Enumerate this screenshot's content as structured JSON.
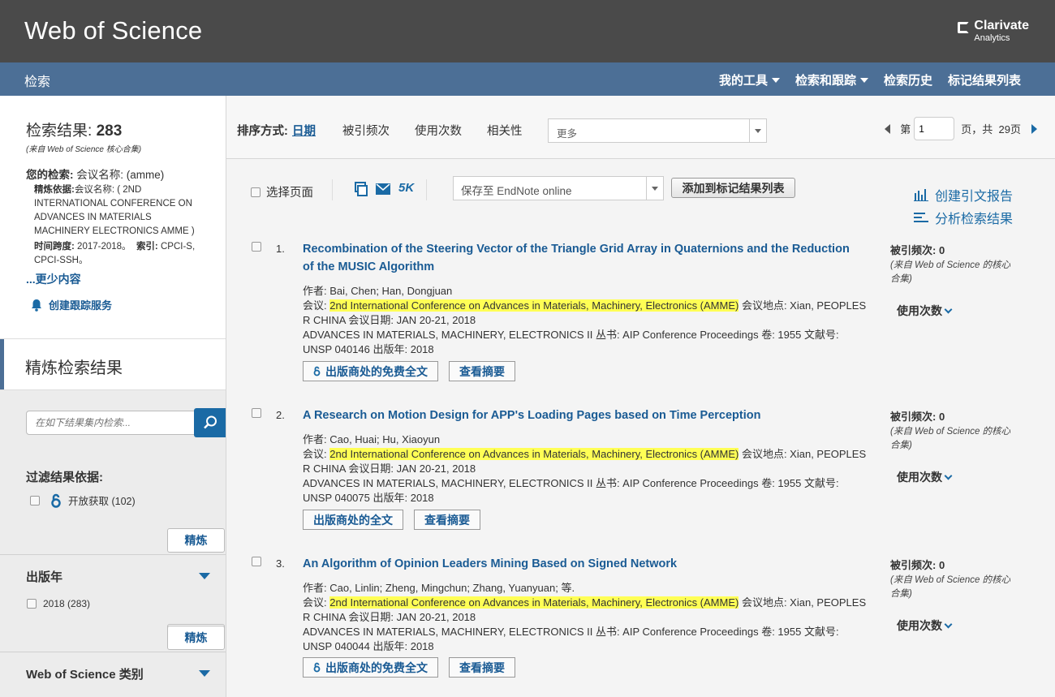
{
  "header": {
    "brand": "Web of Science",
    "logo_line1": "Clarivate",
    "logo_line2": "Analytics"
  },
  "nav": {
    "left": "检索",
    "items": [
      {
        "label": "我的工具",
        "dropdown": true
      },
      {
        "label": "检索和跟踪",
        "dropdown": true
      },
      {
        "label": "检索历史",
        "dropdown": false
      },
      {
        "label": "标记结果列表",
        "dropdown": false
      }
    ]
  },
  "sidebar": {
    "results_label": "检索结果:",
    "results_count": "283",
    "results_source": "(来自 Web of Science 核心合集)",
    "your_search_label": "您的检索:",
    "your_search_value": "会议名称: (amme)",
    "refined_by_label": "精炼依据:",
    "refined_by_value": "会议名称: ( 2ND INTERNATIONAL CONFERENCE ON ADVANCES IN MATERIALS MACHINERY ELECTRONICS AMME )",
    "timespan_label": "时间跨度:",
    "timespan_value": "2017-2018。",
    "index_label": "索引:",
    "index_value": "CPCI-S, CPCI-SSH。",
    "less_link": "...更少内容",
    "create_alert": "创建跟踪服务",
    "refine_title": "精炼检索结果",
    "search_placeholder": "在如下结果集内检索...",
    "filter_title": "过滤结果依据:",
    "open_access": "开放获取 (102)",
    "refine_btn": "精炼",
    "pub_year_title": "出版年",
    "year_2018": "2018 (283)",
    "wos_cat_title": "Web of Science 类别"
  },
  "sort": {
    "label": "排序方式:",
    "options": [
      "日期",
      "被引频次",
      "使用次数",
      "相关性"
    ],
    "more": "更多",
    "page_prefix": "第",
    "page_value": "1",
    "page_suffix": "页，共",
    "total_pages": "29页"
  },
  "toolbar": {
    "select_page": "选择页面",
    "fivek": "5K",
    "save_to": "保存至 EndNote online",
    "add_marked": "添加到标记结果列表",
    "citation_report": "创建引文报告",
    "analyze": "分析检索结果"
  },
  "records": [
    {
      "num": "1.",
      "title": "Recombination of the Steering Vector of the Triangle Grid Array in Quaternions and the Reduction of the MUSIC Algorithm",
      "authors": "作者: Bai, Chen; Han, Dongjuan",
      "conf_prefix": "会议: ",
      "conf_name": "2nd International Conference on Advances in Materials, Machinery, Electronics (AMME)",
      "conf_rest": " 会议地点: Xian, PEOPLES R CHINA 会议日期: JAN 20-21, 2018",
      "source": "ADVANCES IN MATERIALS, MACHINERY, ELECTRONICS II  丛书: AIP Conference Proceedings  卷: 1955   文献号: UNSP 040146  出版年: 2018",
      "btn1": "出版商处的免费全文",
      "btn1_oa": true,
      "btn2": "查看摘要",
      "cites": "被引频次: 0",
      "cites_src": "(来自 Web of Science 的核心合集)",
      "usage": "使用次数"
    },
    {
      "num": "2.",
      "title": "A Research on Motion Design for APP's Loading Pages based on Time Perception",
      "authors": "作者: Cao, Huai; Hu, Xiaoyun",
      "conf_prefix": "会议: ",
      "conf_name": "2nd International Conference on Advances in Materials, Machinery, Electronics (AMME)",
      "conf_rest": " 会议地点: Xian, PEOPLES R CHINA 会议日期: JAN 20-21, 2018",
      "source": "ADVANCES IN MATERIALS, MACHINERY, ELECTRONICS II  丛书: AIP Conference Proceedings  卷: 1955   文献号: UNSP 040075  出版年: 2018",
      "btn1": "出版商处的全文",
      "btn1_oa": false,
      "btn2": "查看摘要",
      "cites": "被引频次: 0",
      "cites_src": "(来自 Web of Science 的核心合集)",
      "usage": "使用次数"
    },
    {
      "num": "3.",
      "title": "An Algorithm of Opinion Leaders Mining Based on Signed Network",
      "authors": "作者: Cao, Linlin; Zheng, Mingchun; Zhang, Yuanyuan; 等.",
      "conf_prefix": "会议: ",
      "conf_name": "2nd International Conference on Advances in Materials, Machinery, Electronics (AMME)",
      "conf_rest": " 会议地点: Xian, PEOPLES R CHINA 会议日期: JAN 20-21, 2018",
      "source": "ADVANCES IN MATERIALS, MACHINERY, ELECTRONICS II  丛书: AIP Conference Proceedings  卷: 1955   文献号: UNSP 040044  出版年: 2018",
      "btn1": "出版商处的免费全文",
      "btn1_oa": true,
      "btn2": "查看摘要",
      "cites": "被引频次: 0",
      "cites_src": "(来自 Web of Science 的核心合集)",
      "usage": "使用次数"
    }
  ],
  "colors": {
    "header": "#4a4a4a",
    "nav": "#4c6f96",
    "link": "#1a5b94",
    "highlight": "#ffff55"
  }
}
